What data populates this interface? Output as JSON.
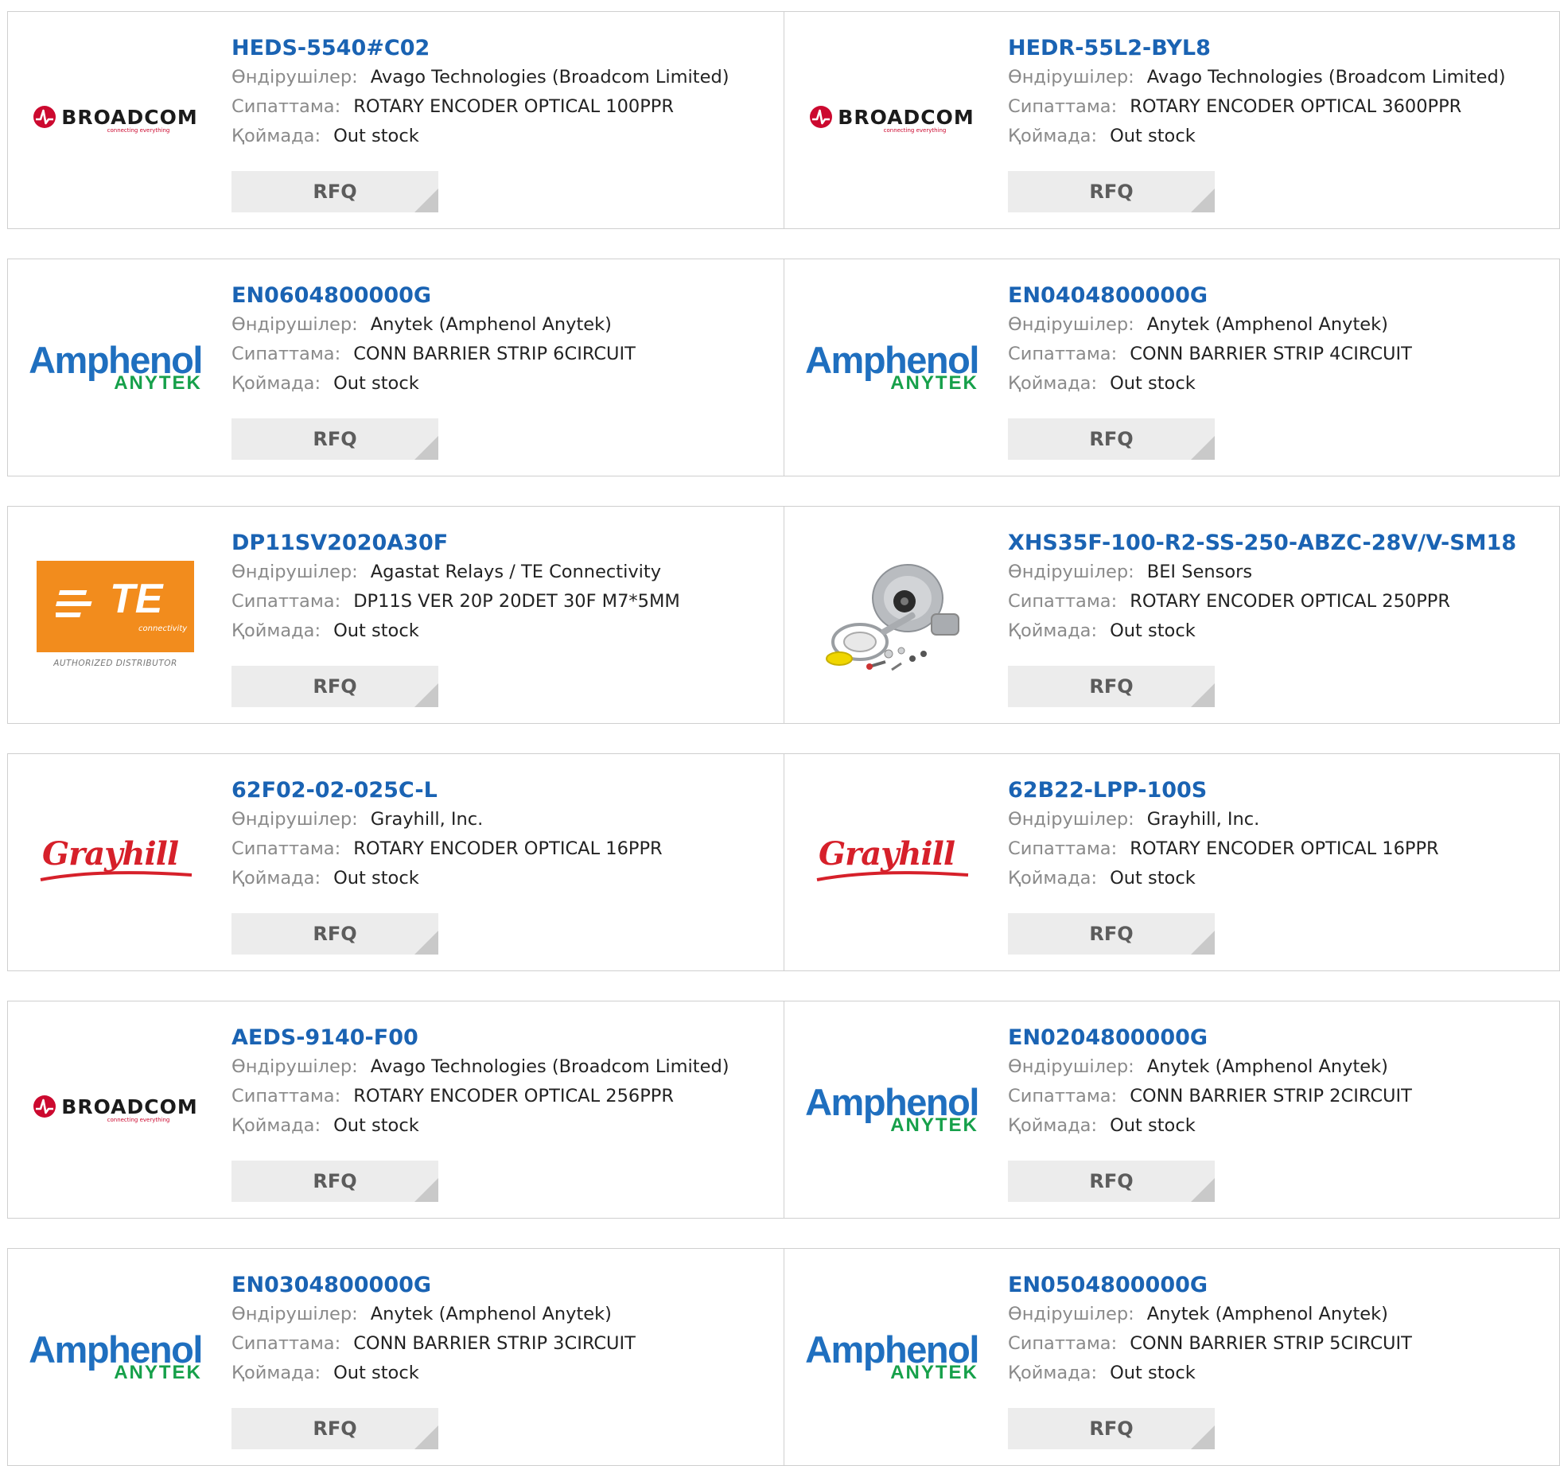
{
  "labels": {
    "manufacturer": "Өндірушілер:",
    "description": "Сипаттама:",
    "stock": "Қоймада:",
    "rfq": "RFQ"
  },
  "logos": {
    "broadcom": {
      "name": "BROADCOM",
      "tagline": "connecting everything",
      "color": "#cc092f"
    },
    "amphenol": {
      "name": "Amphenol",
      "sub": "ANYTEK",
      "color": "#1f6fbf",
      "sub_color": "#16a04a"
    },
    "te": {
      "name": "TE",
      "sub": "connectivity",
      "caption": "AUTHORIZED DISTRIBUTOR",
      "color": "#f28c1d"
    },
    "grayhill": {
      "name": "Grayhill",
      "color": "#d6202a"
    },
    "bei": {
      "icon": "rotary-encoder-product-photo"
    }
  },
  "products": [
    {
      "part": "HEDS-5540#C02",
      "manufacturer": "Avago Technologies (Broadcom Limited)",
      "description": "ROTARY ENCODER OPTICAL 100PPR",
      "stock": "Out stock",
      "logo": "broadcom"
    },
    {
      "part": "HEDR-55L2-BYL8",
      "manufacturer": "Avago Technologies (Broadcom Limited)",
      "description": "ROTARY ENCODER OPTICAL 3600PPR",
      "stock": "Out stock",
      "logo": "broadcom"
    },
    {
      "part": "EN0604800000G",
      "manufacturer": "Anytek (Amphenol Anytek)",
      "description": "CONN BARRIER STRIP 6CIRCUIT",
      "stock": "Out stock",
      "logo": "amphenol"
    },
    {
      "part": "EN0404800000G",
      "manufacturer": "Anytek (Amphenol Anytek)",
      "description": "CONN BARRIER STRIP 4CIRCUIT",
      "stock": "Out stock",
      "logo": "amphenol"
    },
    {
      "part": "DP11SV2020A30F",
      "manufacturer": "Agastat Relays / TE Connectivity",
      "description": "DP11S VER 20P 20DET 30F M7*5MM",
      "stock": "Out stock",
      "logo": "te"
    },
    {
      "part": "XHS35F-100-R2-SS-250-ABZC-28V/V-SM18",
      "manufacturer": "BEI Sensors",
      "description": "ROTARY ENCODER OPTICAL 250PPR",
      "stock": "Out stock",
      "logo": "bei"
    },
    {
      "part": "62F02-02-025C-L",
      "manufacturer": "Grayhill, Inc.",
      "description": "ROTARY ENCODER OPTICAL 16PPR",
      "stock": "Out stock",
      "logo": "grayhill"
    },
    {
      "part": "62B22-LPP-100S",
      "manufacturer": "Grayhill, Inc.",
      "description": "ROTARY ENCODER OPTICAL 16PPR",
      "stock": "Out stock",
      "logo": "grayhill"
    },
    {
      "part": "AEDS-9140-F00",
      "manufacturer": "Avago Technologies (Broadcom Limited)",
      "description": "ROTARY ENCODER OPTICAL 256PPR",
      "stock": "Out stock",
      "logo": "broadcom"
    },
    {
      "part": "EN0204800000G",
      "manufacturer": "Anytek (Amphenol Anytek)",
      "description": "CONN BARRIER STRIP 2CIRCUIT",
      "stock": "Out stock",
      "logo": "amphenol"
    },
    {
      "part": "EN0304800000G",
      "manufacturer": "Anytek (Amphenol Anytek)",
      "description": "CONN BARRIER STRIP 3CIRCUIT",
      "stock": "Out stock",
      "logo": "amphenol"
    },
    {
      "part": "EN0504800000G",
      "manufacturer": "Anytek (Amphenol Anytek)",
      "description": "CONN BARRIER STRIP 5CIRCUIT",
      "stock": "Out stock",
      "logo": "amphenol"
    }
  ]
}
